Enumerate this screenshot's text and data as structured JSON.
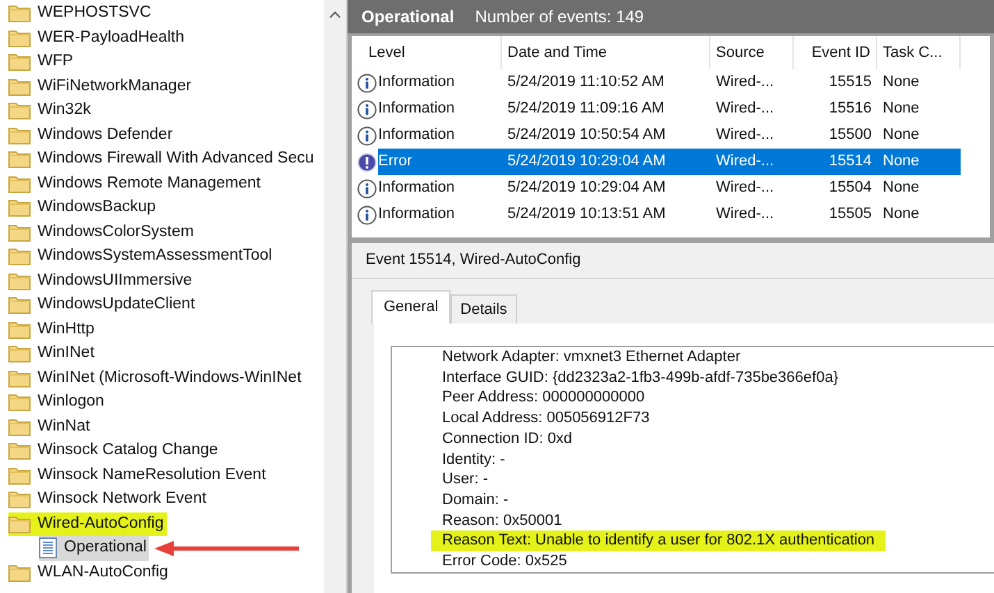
{
  "tree": {
    "items": [
      {
        "label": "WEPHOSTSVC",
        "kind": "folder",
        "selected": false,
        "highlighted": false
      },
      {
        "label": "WER-PayloadHealth",
        "kind": "folder",
        "selected": false,
        "highlighted": false
      },
      {
        "label": "WFP",
        "kind": "folder",
        "selected": false,
        "highlighted": false
      },
      {
        "label": "WiFiNetworkManager",
        "kind": "folder",
        "selected": false,
        "highlighted": false
      },
      {
        "label": "Win32k",
        "kind": "folder",
        "selected": false,
        "highlighted": false
      },
      {
        "label": "Windows Defender",
        "kind": "folder",
        "selected": false,
        "highlighted": false
      },
      {
        "label": "Windows Firewall With Advanced Secu",
        "kind": "folder",
        "selected": false,
        "highlighted": false
      },
      {
        "label": "Windows Remote Management",
        "kind": "folder",
        "selected": false,
        "highlighted": false
      },
      {
        "label": "WindowsBackup",
        "kind": "folder",
        "selected": false,
        "highlighted": false
      },
      {
        "label": "WindowsColorSystem",
        "kind": "folder",
        "selected": false,
        "highlighted": false
      },
      {
        "label": "WindowsSystemAssessmentTool",
        "kind": "folder",
        "selected": false,
        "highlighted": false
      },
      {
        "label": "WindowsUIImmersive",
        "kind": "folder",
        "selected": false,
        "highlighted": false
      },
      {
        "label": "WindowsUpdateClient",
        "kind": "folder",
        "selected": false,
        "highlighted": false
      },
      {
        "label": "WinHttp",
        "kind": "folder",
        "selected": false,
        "highlighted": false
      },
      {
        "label": "WinINet",
        "kind": "folder",
        "selected": false,
        "highlighted": false
      },
      {
        "label": "WinINet (Microsoft-Windows-WinINet",
        "kind": "folder",
        "selected": false,
        "highlighted": false
      },
      {
        "label": "Winlogon",
        "kind": "folder",
        "selected": false,
        "highlighted": false
      },
      {
        "label": "WinNat",
        "kind": "folder",
        "selected": false,
        "highlighted": false
      },
      {
        "label": "Winsock Catalog Change",
        "kind": "folder",
        "selected": false,
        "highlighted": false
      },
      {
        "label": "Winsock NameResolution Event",
        "kind": "folder",
        "selected": false,
        "highlighted": false
      },
      {
        "label": "Winsock Network Event",
        "kind": "folder",
        "selected": false,
        "highlighted": false
      },
      {
        "label": "Wired-AutoConfig",
        "kind": "folder",
        "selected": false,
        "highlighted": true,
        "children": [
          {
            "label": "Operational",
            "kind": "log",
            "selected": true,
            "highlighted": false,
            "annotated": true
          }
        ]
      },
      {
        "label": "WLAN-AutoConfig",
        "kind": "folder",
        "selected": false,
        "highlighted": false
      }
    ]
  },
  "log_header": {
    "title": "Operational",
    "count": "Number of events: 149"
  },
  "events_table": {
    "columns": [
      "Level",
      "Date and Time",
      "Source",
      "Event ID",
      "Task C..."
    ],
    "rows": [
      {
        "level": "Information",
        "kind": "info",
        "date": "5/24/2019 11:10:52 AM",
        "source": "Wired-...",
        "event_id": "15515",
        "task": "None",
        "selected": false
      },
      {
        "level": "Information",
        "kind": "info",
        "date": "5/24/2019 11:09:16 AM",
        "source": "Wired-...",
        "event_id": "15516",
        "task": "None",
        "selected": false
      },
      {
        "level": "Information",
        "kind": "info",
        "date": "5/24/2019 10:50:54 AM",
        "source": "Wired-...",
        "event_id": "15500",
        "task": "None",
        "selected": false
      },
      {
        "level": "Error",
        "kind": "error",
        "date": "5/24/2019 10:29:04 AM",
        "source": "Wired-...",
        "event_id": "15514",
        "task": "None",
        "selected": true
      },
      {
        "level": "Information",
        "kind": "info",
        "date": "5/24/2019 10:29:04 AM",
        "source": "Wired-...",
        "event_id": "15504",
        "task": "None",
        "selected": false
      },
      {
        "level": "Information",
        "kind": "info",
        "date": "5/24/2019 10:13:51 AM",
        "source": "Wired-...",
        "event_id": "15505",
        "task": "None",
        "selected": false
      }
    ]
  },
  "event_detail": {
    "title": "Event 15514, Wired-AutoConfig",
    "tabs": [
      {
        "label": "General",
        "selected": true
      },
      {
        "label": "Details",
        "selected": false
      }
    ],
    "lines": [
      {
        "text": "Network Adapter: vmxnet3 Ethernet Adapter",
        "highlighted": false
      },
      {
        "text": "Interface GUID: {dd2323a2-1fb3-499b-afdf-735be366ef0a}",
        "highlighted": false
      },
      {
        "text": "Peer Address: 000000000000",
        "highlighted": false
      },
      {
        "text": "Local Address: 005056912F73",
        "highlighted": false
      },
      {
        "text": "Connection ID: 0xd",
        "highlighted": false
      },
      {
        "text": "Identity: -",
        "highlighted": false
      },
      {
        "text": "User: -",
        "highlighted": false
      },
      {
        "text": "Domain: -",
        "highlighted": false
      },
      {
        "text": "Reason: 0x50001",
        "highlighted": false
      },
      {
        "text": "Reason Text: Unable to identify a user for 802.1X authentication",
        "highlighted": true
      },
      {
        "text": "Error Code: 0x525",
        "highlighted": false
      }
    ]
  }
}
